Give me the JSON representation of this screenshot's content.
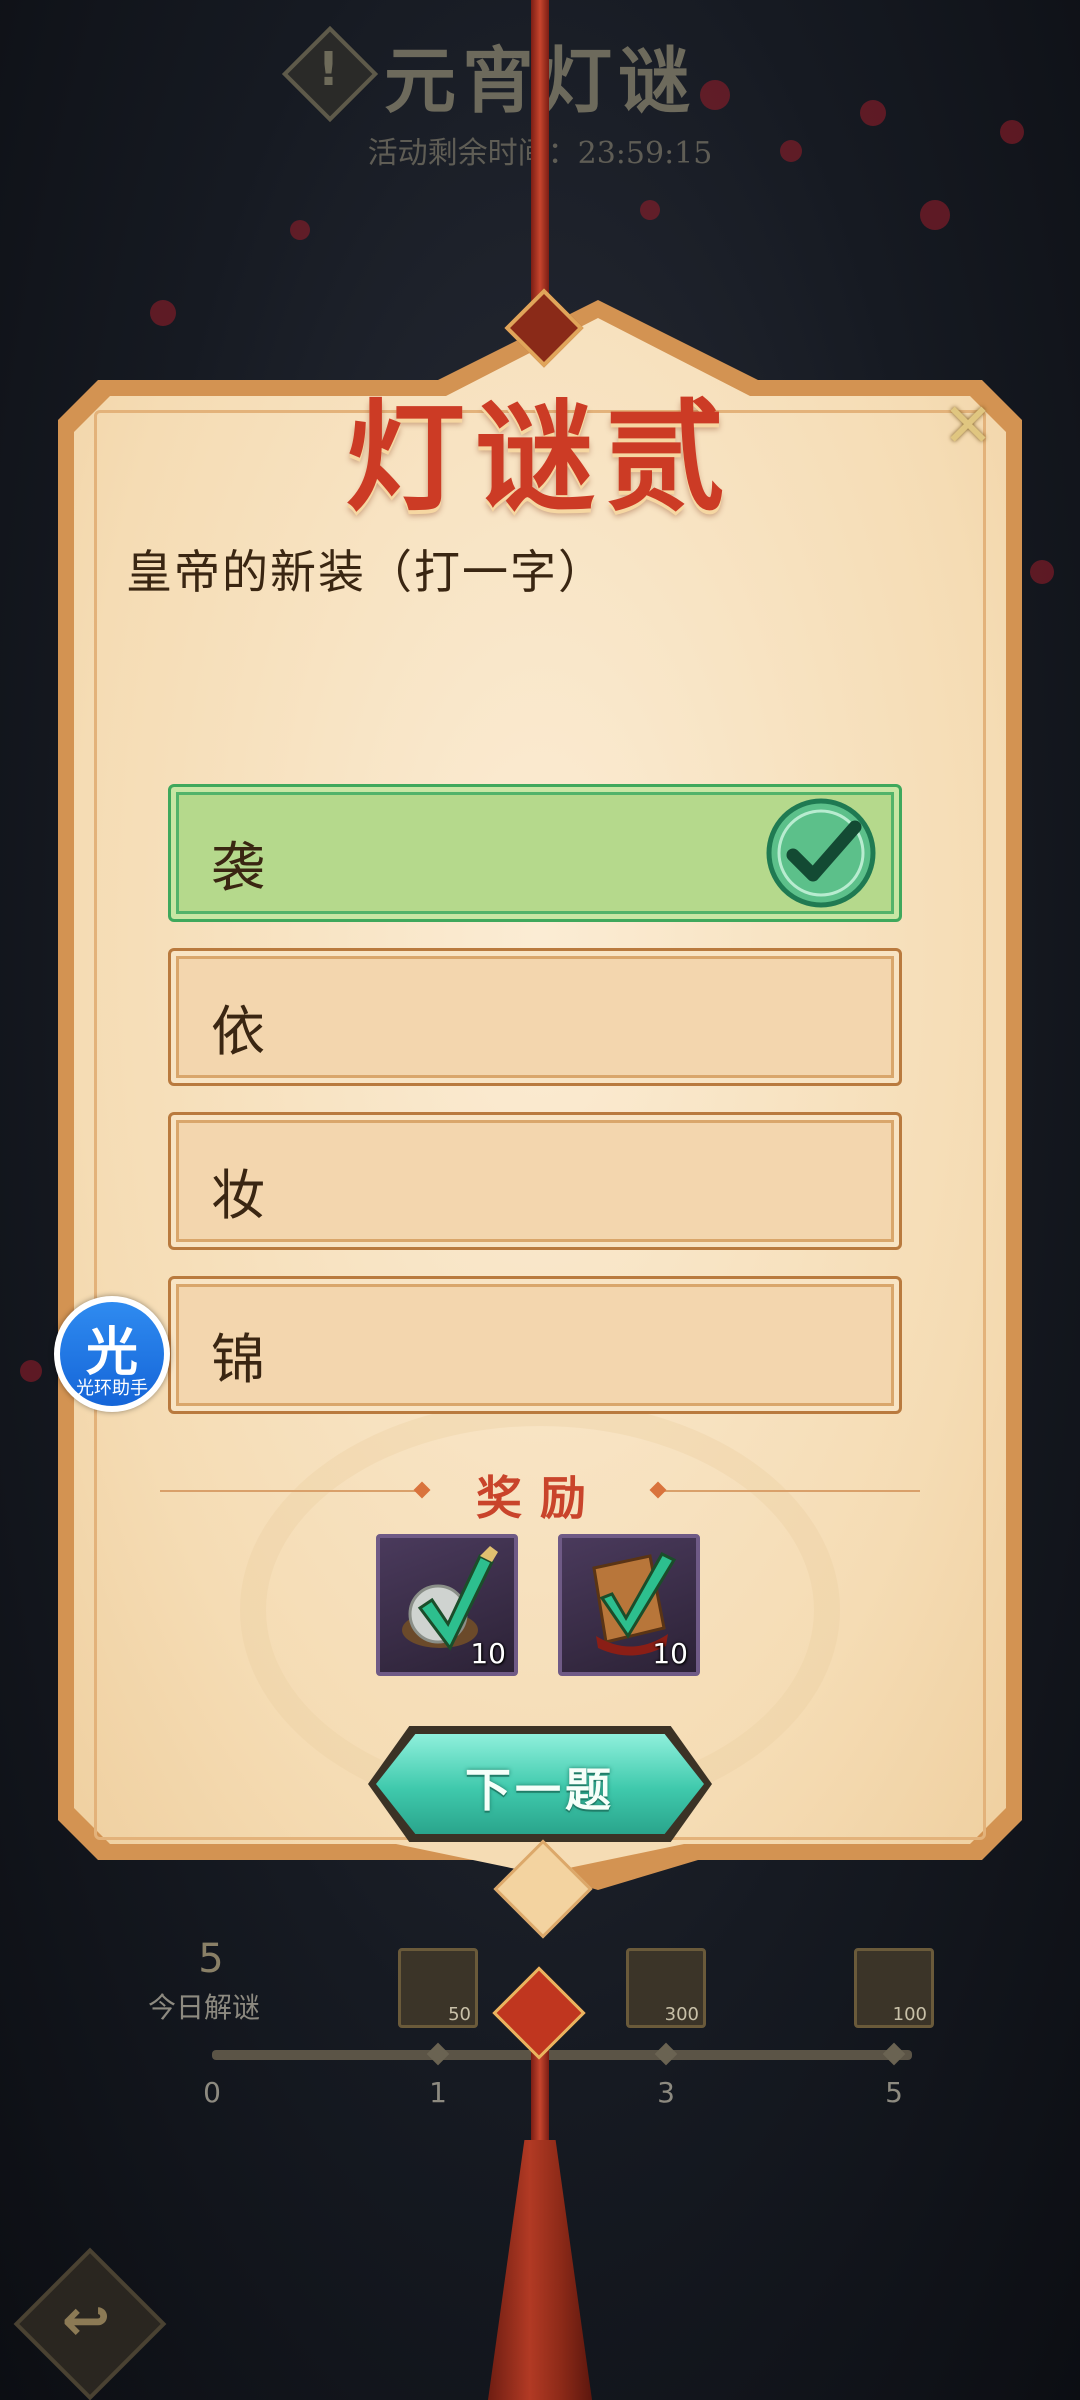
{
  "background": {
    "event_title": "元宵灯谜",
    "timer_text": "活动剩余时间：23:59:15",
    "warning_mark": "!"
  },
  "card": {
    "title": "灯谜贰",
    "close_icon": "✕",
    "question": "皇帝的新装（打一字）",
    "options": [
      {
        "label": "袭",
        "state": "correct"
      },
      {
        "label": "依",
        "state": "normal"
      },
      {
        "label": "妆",
        "state": "normal"
      },
      {
        "label": "锦",
        "state": "normal"
      }
    ],
    "reward_title": "奖励",
    "rewards": [
      {
        "icon": "pearl-scroll-icon",
        "quantity": "10"
      },
      {
        "icon": "wood-token-icon",
        "quantity": "10"
      }
    ],
    "next_button": "下一题"
  },
  "progress": {
    "today_count": "5",
    "today_label": "今日解谜",
    "nodes": [
      "0",
      "1",
      "3",
      "5"
    ],
    "milestone_quantities": [
      "50",
      "300",
      "100"
    ]
  },
  "assistant": {
    "char": "光",
    "label": "光环助手"
  },
  "colors": {
    "card_bg": "#f5dcb4",
    "correct_bg": "#b5d98c",
    "title_red": "#cc3b25",
    "next_teal": "#3fc9ac"
  }
}
